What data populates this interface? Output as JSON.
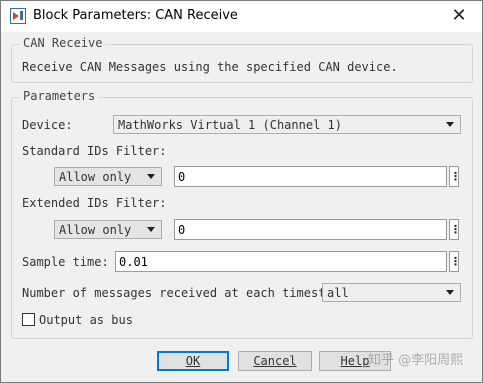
{
  "window": {
    "title": "Block Parameters: CAN Receive"
  },
  "block_group": {
    "label": "CAN Receive",
    "description": "Receive CAN Messages using the specified CAN device."
  },
  "params_group": {
    "label": "Parameters"
  },
  "device": {
    "label": "Device:",
    "value": "MathWorks Virtual 1 (Channel 1)"
  },
  "std_filter": {
    "label": "Standard IDs Filter:",
    "mode": "Allow only",
    "value": "0"
  },
  "ext_filter": {
    "label": "Extended IDs Filter:",
    "mode": "Allow only",
    "value": "0"
  },
  "sample_time": {
    "label": "Sample time:",
    "value": "0.01"
  },
  "num_messages": {
    "label": "Number of messages received at each timestep:",
    "value": "all"
  },
  "output_as_bus": {
    "label": "Output as bus",
    "checked": false
  },
  "buttons": {
    "ok": "OK",
    "cancel": "Cancel",
    "help": "Help"
  },
  "watermark": "知乎 @李阳周熙",
  "icons": {
    "app": "simulink-block-icon",
    "close": "close-icon",
    "dropdown": "chevron-down-icon",
    "more": "more-options-icon"
  }
}
